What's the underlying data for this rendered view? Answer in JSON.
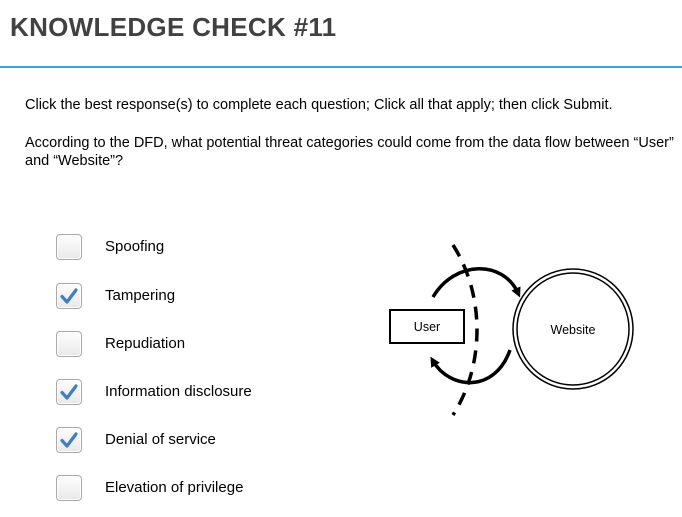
{
  "header": {
    "title": "KNOWLEDGE CHECK #11",
    "accent_color": "#35a7d6"
  },
  "instructions": "Click the best response(s) to complete each question; Click all that apply; then click Submit.",
  "question": "According to the DFD, what potential threat categories could come from the data flow between “User” and “Website”?",
  "options": [
    {
      "label": "Spoofing",
      "checked": false
    },
    {
      "label": "Tampering",
      "checked": true
    },
    {
      "label": "Repudiation",
      "checked": false
    },
    {
      "label": "Information disclosure",
      "checked": true
    },
    {
      "label": "Denial of service",
      "checked": true
    },
    {
      "label": "Elevation of privilege",
      "checked": false
    }
  ],
  "check_color": "#3d7fc1",
  "diagram": {
    "user_label": "User",
    "website_label": "Website"
  }
}
